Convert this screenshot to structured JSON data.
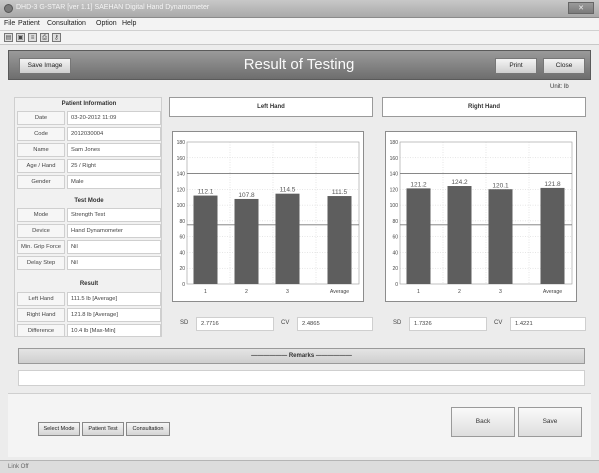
{
  "window": {
    "title": "DHD-3 G-STAR [ver 1.1] SAEHAN Digital Hand Dynamometer",
    "close": "✕"
  },
  "menu": [
    "File",
    "Patient",
    "Consultation",
    "Option",
    "Help"
  ],
  "toolbar_icons": [
    {
      "name": "new-icon",
      "glyph": "▤"
    },
    {
      "name": "save-icon",
      "glyph": "▣"
    },
    {
      "name": "list-icon",
      "glyph": "≡"
    },
    {
      "name": "print-icon",
      "glyph": "⎙"
    },
    {
      "name": "key-icon",
      "glyph": "⚷"
    }
  ],
  "header": {
    "save_image": "Save Image",
    "title": "Result of Testing",
    "print": "Print",
    "close": "Close"
  },
  "unit": "Unit: lb",
  "patient": {
    "heading": "Patient Information",
    "rows": [
      {
        "label": "Date",
        "value": "03-20-2012  11:09"
      },
      {
        "label": "Code",
        "value": "2012030004"
      },
      {
        "label": "Name",
        "value": "Sam Jones"
      },
      {
        "label": "Age / Hand",
        "value": "25 / Right"
      },
      {
        "label": "Gender",
        "value": "Male"
      }
    ]
  },
  "test_mode": {
    "heading": "Test Mode",
    "rows": [
      {
        "label": "Mode",
        "value": "Strength Test"
      },
      {
        "label": "Device",
        "value": "Hand Dynamometer"
      },
      {
        "label": "Min. Grip Force",
        "value": "Nil"
      },
      {
        "label": "Delay Step",
        "value": "Nil"
      }
    ]
  },
  "result": {
    "heading": "Result",
    "rows": [
      {
        "label": "Left Hand",
        "value": "111.5 lb [Average]"
      },
      {
        "label": "Right Hand",
        "value": "121.8 lb [Average]"
      },
      {
        "label": "Difference",
        "value": "10.4 lb [Max-Min]"
      }
    ]
  },
  "left": {
    "title": "Left Hand",
    "sd_label": "SD",
    "sd": "2.7716",
    "cv_label": "CV",
    "cv": "2.4865"
  },
  "right": {
    "title": "Right Hand",
    "sd_label": "SD",
    "sd": "1.7326",
    "cv_label": "CV",
    "cv": "1.4221"
  },
  "remarks": "Remarks",
  "buttons": {
    "select_mode": "Select Mode",
    "patient_test": "Patient Test",
    "consultation": "Consultation",
    "back": "Back",
    "save": "Save"
  },
  "status": "Link Off",
  "chart_data": [
    {
      "type": "bar",
      "title": "",
      "categories": [
        "1",
        "2",
        "3",
        "Average"
      ],
      "values": [
        112.1,
        107.8,
        114.5,
        111.5
      ],
      "labels": [
        "112.1",
        "107.8",
        "114.5",
        "111.5"
      ],
      "yticks": [
        "0",
        "20",
        "40",
        "60",
        "80",
        "100",
        "120",
        "140",
        "160",
        "180"
      ],
      "ylim": [
        0,
        180
      ],
      "reference_lines": [
        75,
        140
      ]
    },
    {
      "type": "bar",
      "title": "",
      "categories": [
        "1",
        "2",
        "3",
        "Average"
      ],
      "values": [
        121.2,
        124.2,
        120.1,
        121.8
      ],
      "labels": [
        "121.2",
        "124.2",
        "120.1",
        "121.8"
      ],
      "yticks": [
        "0",
        "20",
        "40",
        "60",
        "80",
        "100",
        "120",
        "140",
        "160",
        "180"
      ],
      "ylim": [
        0,
        180
      ],
      "reference_lines": [
        75,
        140
      ]
    }
  ],
  "colors": {
    "bar": "#5e5e5e",
    "header": "#7e7e7e",
    "grid": "#c0c0c0",
    "ref_line": "#777777"
  }
}
